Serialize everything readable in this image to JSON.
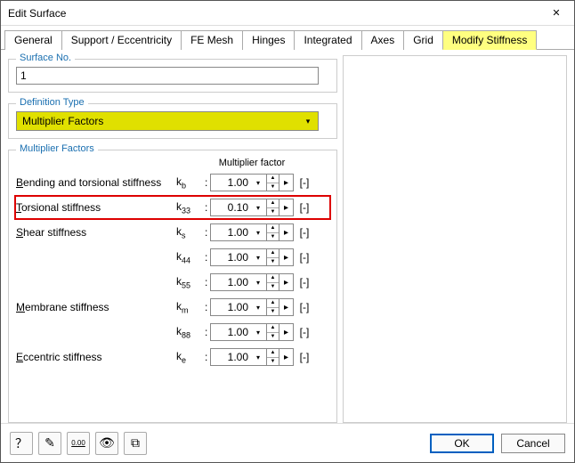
{
  "window": {
    "title": "Edit Surface"
  },
  "tabs": {
    "items": [
      {
        "label": "General"
      },
      {
        "label": "Support / Eccentricity"
      },
      {
        "label": "FE Mesh"
      },
      {
        "label": "Hinges"
      },
      {
        "label": "Integrated"
      },
      {
        "label": "Axes"
      },
      {
        "label": "Grid"
      },
      {
        "label": "Modify Stiffness"
      }
    ],
    "active_index": 7
  },
  "surface_no": {
    "title": "Surface No.",
    "value": "1"
  },
  "definition_type": {
    "title": "Definition Type",
    "value": "Multiplier Factors"
  },
  "multiplier_factors": {
    "title": "Multiplier Factors",
    "header": "Multiplier factor",
    "rows": [
      {
        "label_pre": "B",
        "label_rest": "ending and torsional stiffness",
        "symbol": "b",
        "value": "1.00",
        "unit": "[-]",
        "highlight": false
      },
      {
        "label_pre": "T",
        "label_rest": "orsional stiffness",
        "symbol": "33",
        "value": "0.10",
        "unit": "[-]",
        "highlight": true
      },
      {
        "label_pre": "S",
        "label_rest": "hear stiffness",
        "symbol": "s",
        "value": "1.00",
        "unit": "[-]",
        "highlight": false
      },
      {
        "label_pre": "",
        "label_rest": "",
        "symbol": "44",
        "value": "1.00",
        "unit": "[-]",
        "highlight": false
      },
      {
        "label_pre": "",
        "label_rest": "",
        "symbol": "55",
        "value": "1.00",
        "unit": "[-]",
        "highlight": false
      },
      {
        "label_pre": "M",
        "label_rest": "embrane stiffness",
        "symbol": "m",
        "value": "1.00",
        "unit": "[-]",
        "highlight": false
      },
      {
        "label_pre": "",
        "label_rest": "",
        "symbol": "88",
        "value": "1.00",
        "unit": "[-]",
        "highlight": false
      },
      {
        "label_pre": "E",
        "label_rest": "ccentric stiffness",
        "symbol": "e",
        "value": "1.00",
        "unit": "[-]",
        "highlight": false
      }
    ]
  },
  "footer": {
    "ok": "OK",
    "cancel": "Cancel"
  },
  "icons": {
    "help": "？",
    "edit": "✎",
    "zero": "0.00",
    "eye": "👁",
    "excel": "⧉"
  }
}
